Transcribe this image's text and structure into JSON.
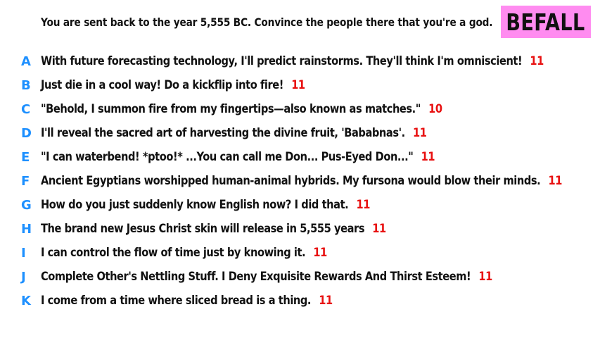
{
  "header": {
    "prompt": "You are sent back to the year 5,555 BC. Convince the people there that you're a god.",
    "badge": "BEFALL"
  },
  "answers": [
    {
      "letter": "A",
      "text": "With future forecasting technology, I'll predict rainstorms. They'll think I'm omniscient!",
      "score": "11"
    },
    {
      "letter": "B",
      "text": "Just die in a cool way! Do a kickflip into fire!",
      "score": "11"
    },
    {
      "letter": "C",
      "text": "\"Behold, I summon fire from my fingertips—also known as matches.\"",
      "score": "10"
    },
    {
      "letter": "D",
      "text": "I'll reveal the sacred art of harvesting the divine fruit, 'Bababnas'.",
      "score": "11"
    },
    {
      "letter": "E",
      "text": "\"I can waterbend! *ptoo!* ...You can call me Don... Pus-Eyed Don...\"",
      "score": "11"
    },
    {
      "letter": "F",
      "text": "Ancient Egyptians worshipped human-animal hybrids. My fursona would blow their minds.",
      "score": "11"
    },
    {
      "letter": "G",
      "text": "How do you just suddenly know English now? I did that.",
      "score": "11"
    },
    {
      "letter": "H",
      "text": "The brand new Jesus Christ skin will release in 5,555 years",
      "score": "11"
    },
    {
      "letter": "I",
      "text": "I can control the flow of time just by knowing it.",
      "score": "11"
    },
    {
      "letter": "J",
      "text": "Complete Other's Nettling Stuff. I Deny Exquisite Rewards And Thirst Esteem!",
      "score": "11"
    },
    {
      "letter": "K",
      "text": "I come from a time where sliced bread is a thing.",
      "score": "11"
    }
  ],
  "colors": {
    "letter": "#1e90ff",
    "score": "#e81010",
    "badge_bg": "#ff8cf0"
  }
}
